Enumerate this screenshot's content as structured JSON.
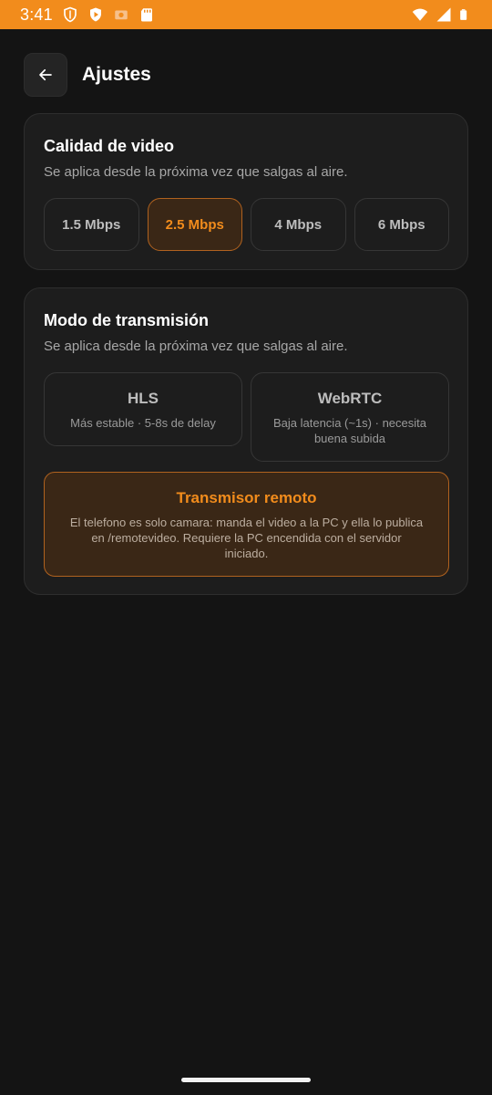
{
  "status_bar": {
    "time": "3:41",
    "icons_left": [
      "shield-icon",
      "play-store-icon",
      "photo-icon",
      "sd-card-icon"
    ],
    "icons_right": [
      "wifi-icon",
      "signal-icon",
      "battery-icon"
    ],
    "color": "#f28c1c"
  },
  "header": {
    "back_icon": "arrow-left-icon",
    "title": "Ajustes"
  },
  "quality_card": {
    "title": "Calidad de video",
    "subtitle": "Se aplica desde la próxima vez que salgas al aire.",
    "options": [
      "1.5 Mbps",
      "2.5 Mbps",
      "4 Mbps",
      "6 Mbps"
    ],
    "selected": "2.5 Mbps"
  },
  "mode_card": {
    "title": "Modo de transmisión",
    "subtitle": "Se aplica desde la próxima vez que salgas al aire.",
    "hls": {
      "title": "HLS",
      "description": "Más estable · 5-8s de delay"
    },
    "webrtc": {
      "title": "WebRTC",
      "description": "Baja latencia (~1s) · necesita buena subida"
    },
    "remote": {
      "title": "Transmisor remoto",
      "description": "El telefono es solo camara: manda el video a la PC y ella lo publica en /remotevideo. Requiere la PC encendida con el servidor iniciado.",
      "selected": true
    }
  },
  "colors": {
    "accent": "#f28c1c",
    "background": "#141414",
    "card": "#1d1d1d",
    "selected_fill": "#3a2716"
  }
}
